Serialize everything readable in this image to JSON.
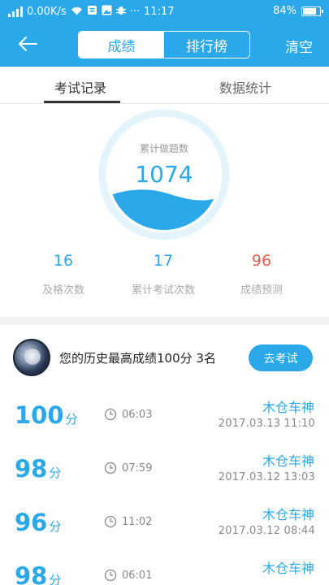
{
  "status_bar": {
    "network_speed": "0.00K/s",
    "time": "11:17",
    "battery_text": "84%",
    "battery_level": 0.84,
    "icons": [
      "signal-icon",
      "wifi-icon",
      "notification-icon",
      "image-icon",
      "bug-icon",
      "more-icon"
    ]
  },
  "header": {
    "tabs": [
      {
        "label": "成绩",
        "active": true
      },
      {
        "label": "排行榜",
        "active": false
      }
    ],
    "clear_label": "清空",
    "back_icon": "arrow-left-icon"
  },
  "subtabs": [
    {
      "label": "考试记录",
      "active": true
    },
    {
      "label": "数据统计",
      "active": false
    }
  ],
  "gauge": {
    "title": "累计做题数",
    "value": "1074"
  },
  "stats": [
    {
      "value": "16",
      "label": "及格次数"
    },
    {
      "value": "17",
      "label": "累计考试次数"
    },
    {
      "value": "96",
      "label": "成绩预测"
    }
  ],
  "best": {
    "text": "您的历史最高成绩100分  3名",
    "button_label": "去考试"
  },
  "records": [
    {
      "score": "100",
      "unit": "分",
      "duration": "06:03",
      "name": "木仓车神",
      "datetime": "2017.03.13   11:10"
    },
    {
      "score": "98",
      "unit": "分",
      "duration": "07:59",
      "name": "木仓车神",
      "datetime": "2017.03.12   13:03"
    },
    {
      "score": "96",
      "unit": "分",
      "duration": "11:02",
      "name": "木仓车神",
      "datetime": "2017.03.12   08:44"
    },
    {
      "score": "98",
      "unit": "分",
      "duration": "06:01",
      "name": "木仓车神",
      "datetime": ""
    }
  ],
  "colors": {
    "accent": "#2aa8ea",
    "predict": "#e25c4f"
  }
}
